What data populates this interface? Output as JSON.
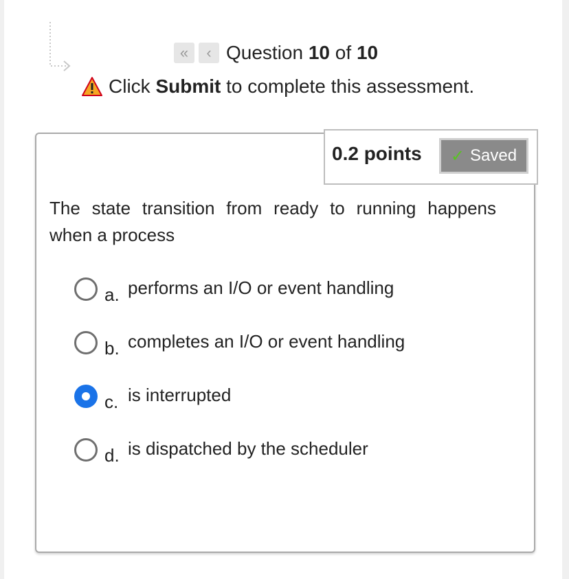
{
  "navigation": {
    "first_icon": "double-chevron-left-icon",
    "prev_icon": "chevron-left-icon",
    "question_prefix": "Question",
    "current": "10",
    "of_text": "of",
    "total": "10"
  },
  "notice": {
    "icon": "warning-icon",
    "before": "Click",
    "bold": "Submit",
    "after": "to complete this assessment."
  },
  "question": {
    "points": "0.2 points",
    "saved_label": "Saved",
    "text": "The state transition from ready to running happens when a process",
    "options": [
      {
        "letter": "a.",
        "text": "performs an I/O or event handling",
        "selected": false
      },
      {
        "letter": "b.",
        "text": "completes an I/O or event handling",
        "selected": false
      },
      {
        "letter": "c.",
        "text": "is interrupted",
        "selected": true
      },
      {
        "letter": "d.",
        "text": "is dispatched by the scheduler",
        "selected": false
      }
    ]
  },
  "colors": {
    "accent": "#1a73e8",
    "saved_bg": "#8a8a8a",
    "check": "#58c322",
    "warning": "#f5a623"
  }
}
